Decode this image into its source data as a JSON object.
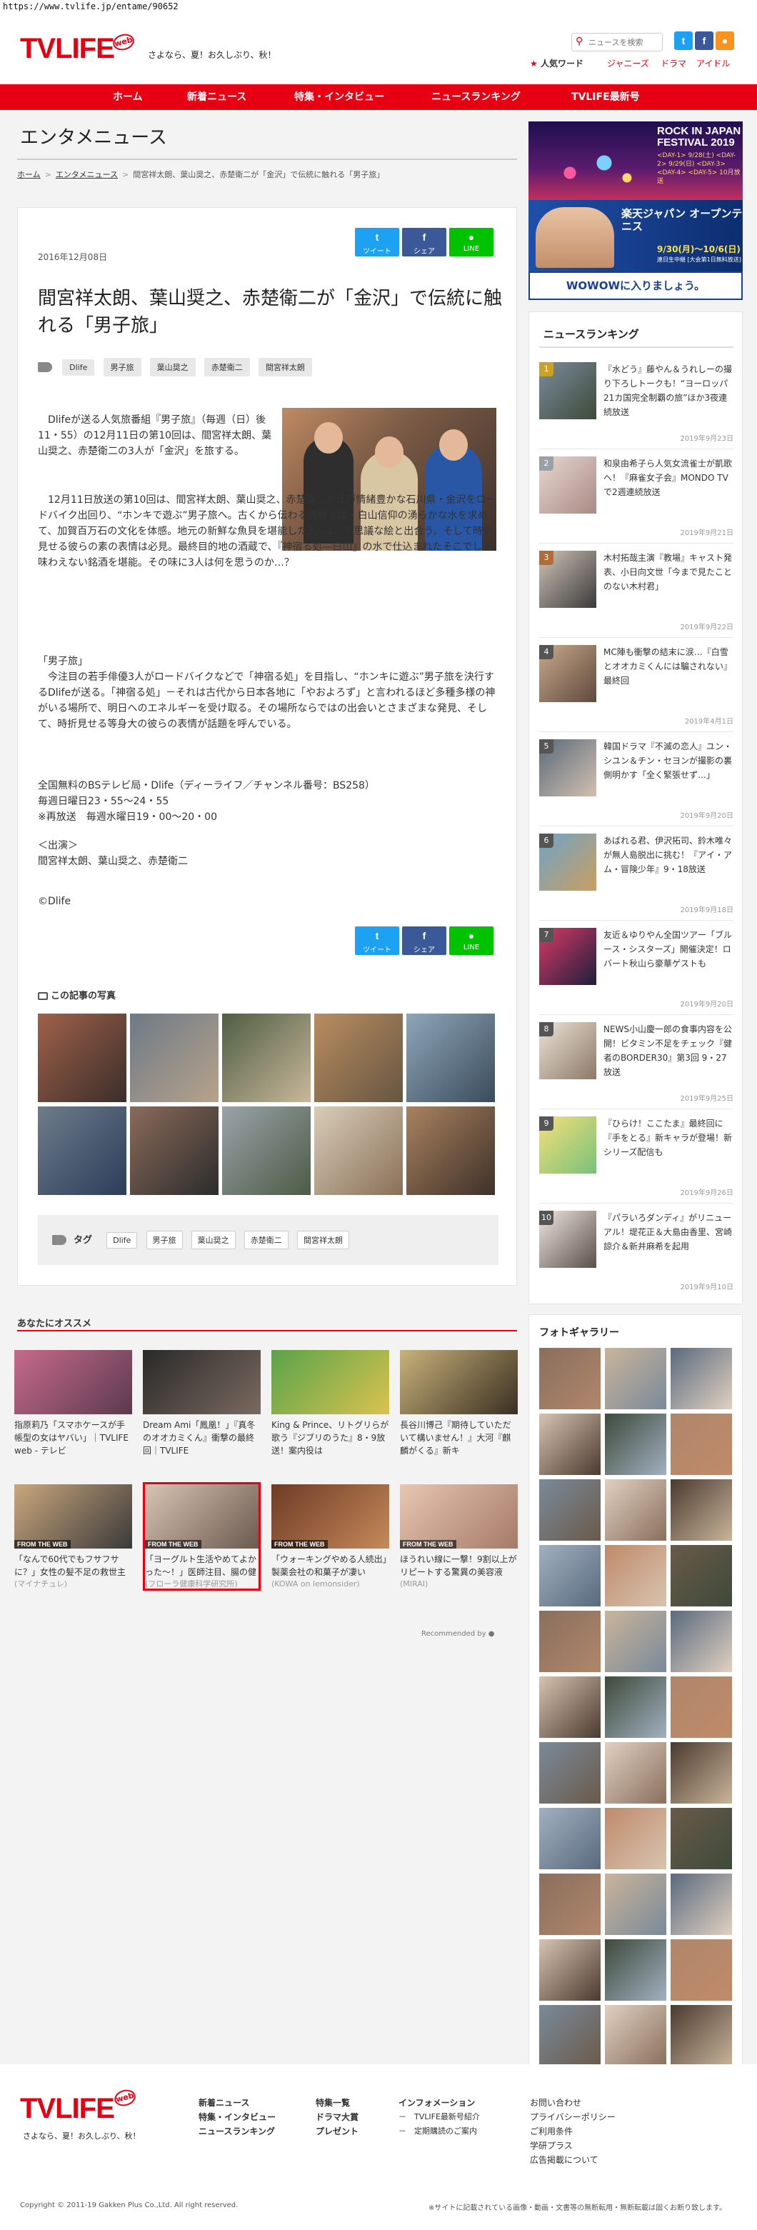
{
  "url": "https://www.tvlife.jp/entame/90652",
  "header": {
    "logo": "TVLIFE",
    "logo_badge": "web",
    "tagline": "さよなら、夏！お久しぶり、秋！",
    "search_placeholder": "ニュースを検索",
    "popular_label": "人気ワード",
    "popular_words": [
      "ジャニーズ",
      "ドラマ",
      "アイドル"
    ]
  },
  "nav": [
    "ホーム",
    "新着ニュース",
    "特集・インタビュー",
    "ニュースランキング",
    "TVLIFE最新号"
  ],
  "section_title": "エンタメニュース",
  "breadcrumb": [
    "ホーム",
    "エンタメニュース",
    "間宮祥太朗、葉山奨之、赤楚衛二が「金沢」で伝統に触れる「男子旅」"
  ],
  "article": {
    "date": "2016年12月08日",
    "share": [
      {
        "icon": "t",
        "label": "ツイート"
      },
      {
        "icon": "f",
        "label": "シェア"
      },
      {
        "icon": "●",
        "label": "LINE"
      }
    ],
    "headline": "間宮祥太朗、葉山奨之、赤楚衛二が「金沢」で伝統に触れる「男子旅」",
    "tags": [
      "Dlife",
      "男子旅",
      "葉山奨之",
      "赤楚衛二",
      "間宮祥太朗"
    ],
    "p1": "Dlifeが送る人気旅番組『男子旅』（毎週（日）後11・55）の12月11日の第10回は、間宮祥太朗、葉山奨之、赤楚衛二の3人が「金沢」を旅する。",
    "p2": "12月11日放送の第10回は、間宮祥太朗、葉山奨之、赤楚衛二が江戸情緒豊かな石川県・金沢をロードバイク出回り、“ホンキで遊ぶ”男子旅へ。古くから伝わる秀麗な峰・白山信仰の湧らかな水を求めて、加賀百万石の文化を体感。地元の新鮮な魚貝を堪能した3人は、不思議な絵と出合う。そして時折見せる彼らの素の表情は必見。最終目的地の酒蔵で、『神宿る処―白山』の水で仕込まれたそこでしか味わえない銘酒を堪能。その味に3人は何を思うのか…？",
    "p3_head": "「男子旅」",
    "p3": "今注目の若手俳優3人がロードバイクなどで「神宿る処」を目指し、“ホンキに遊ぶ”男子旅を決行するDlifeが送る。「神宿る処」－それは古代から日本各地に「やおよろず」と言われるほど多種多様の神がいる場所で、明日へのエネルギーを受け取る。その場所ならではの出会いとさまざまな発見、そして、時折見せる等身大の彼らの表情が話題を呼んでいる。",
    "p4": "全国無料のBSテレビ局・Dlife（ディーライフ／チャンネル番号：BS258）\n毎週日曜日23・55〜24・55\n※再放送　毎週水曜日19・00〜20・00",
    "p5": "＜出演＞\n間宮祥太朗、葉山奨之、赤楚衛二",
    "p6": "©Dlife",
    "photos_head": "この記事の写真",
    "tags_label": "タグ"
  },
  "reco": {
    "title": "あなたにオススメ",
    "items": [
      {
        "text": "指原莉乃「スマホケースが手帳型の女はヤバい」｜TVLIFE web - テレビ",
        "source": ""
      },
      {
        "text": "Dream Ami「鳳凰！」『真冬のオオカミくん』衝撃の最終回｜TVLIFE",
        "source": ""
      },
      {
        "text": "King & Prince、リトグリらが歌う『ジブリのうた』8・9放送！案内役は",
        "source": ""
      },
      {
        "text": "長谷川博己『期待していただいて構いません！』大河『麒麟がくる』新キ",
        "source": ""
      },
      {
        "text": "「なんで60代でもフサフサに？」女性の髪不足の救世主がスゴイ",
        "source": "(マイナチュレ)"
      },
      {
        "text": "「ヨーグルト生活やめてよかった～！」医師注目、腸の健康ウラワ",
        "source": "(フローラ健康科学研究所)"
      },
      {
        "text": "「ウォーキングやめる人続出」製薬会社の和菓子が凄い",
        "source": "(KOWA on lemonsider)"
      },
      {
        "text": "ほうれい線に一撃！9割以上がリピートする驚異の美容液",
        "source": "(MIRAI)"
      }
    ],
    "from_web": "FROM THE WEB",
    "recommended_by": "Recommended by"
  },
  "sidebar": {
    "ad": {
      "t1": "ROCK IN JAPAN FESTIVAL 2019",
      "t2": "<DAY-1> 9/28(土) <DAY-2> 9/29(日) <DAY-3> <DAY-4> <DAY-5> 10月放送",
      "t3": "楽天ジャパン オープンテニス",
      "t4": "9/30(月)〜10/6(日)",
      "t5": "連日生中継 [大会第1日無料放送]",
      "cta": "WOWOWに入りましょう。"
    },
    "ranking_title": "ニュースランキング",
    "ranking": [
      {
        "rank": "1",
        "text": "『水どう』藤やん＆うれしーの撮り下ろしトークも！“ヨーロッパ21カ国完全制覇の旅”ほか3夜連続放送",
        "date": "2019年9月23日"
      },
      {
        "rank": "2",
        "text": "和泉由希子ら人気女流雀士が凱歌へ！『麻雀女子会』MONDO TVで2週連続放送",
        "date": "2019年9月21日"
      },
      {
        "rank": "3",
        "text": "木村拓哉主演『教場』キャスト発表、小日向文世「今まで見たことのない木村君」",
        "date": "2019年9月22日"
      },
      {
        "rank": "4",
        "text": "MC陣も衝撃の結末に涙…『白雪とオオカミくんには騙されない』最終回",
        "date": "2019年4月1日"
      },
      {
        "rank": "5",
        "text": "韓国ドラマ『不滅の恋人』ユン・シユン＆チン・セヨンが撮影の裏側明かす「全く緊張せず…」",
        "date": "2019年9月20日"
      },
      {
        "rank": "6",
        "text": "あばれる君、伊沢拓司、鈴木唯々が無人島脱出に挑む！『アイ・アム・冒険少年』9・18放送",
        "date": "2019年9月18日"
      },
      {
        "rank": "7",
        "text": "友近＆ゆりやん全国ツアー「ブルース・シスターズ」開催決定！ロバート秋山ら豪華ゲストも",
        "date": "2019年9月20日"
      },
      {
        "rank": "8",
        "text": "NEWS小山慶一郎の食事内容を公開！ビタミン不足をチェック『健者のBORDER30』第3回 9・27放送",
        "date": "2019年9月25日"
      },
      {
        "rank": "9",
        "text": "『ひらけ！ここたま』最終回に『手をとる』新キャラが登場！新シリーズ配信も",
        "date": "2019年9月26日"
      },
      {
        "rank": "10",
        "text": "『パラいろダンディ』がリニューアル！堤花正＆大島由香里、宮崎諒介＆新井麻希を起用",
        "date": "2019年9月10日"
      }
    ],
    "gallery_title": "フォトギャラリー"
  },
  "footer": {
    "logo": "TVLIFE",
    "logo_badge": "web",
    "tagline": "さよなら、夏！お久しぶり、秋！",
    "col1": [
      "新着ニュース",
      "特集・インタビュー",
      "ニュースランキング"
    ],
    "col2": [
      "特集一覧",
      "ドラマ大賞",
      "プレゼント"
    ],
    "col3": [
      "インフォメーション",
      "－　TVLIFE最新号紹介",
      "－　定期購読のご案内"
    ],
    "col4": [
      "お問い合わせ",
      "プライバシーポリシー",
      "ご利用条件",
      "学研プラス",
      "広告掲載について"
    ],
    "copyright": "Copyright © 2011-19 Gakken Plus Co.,Ltd. All right reserved.",
    "notice": "※サイトに記載されている画像・動画・文書等の無断転用・無断転載は固くお断り致します。"
  }
}
